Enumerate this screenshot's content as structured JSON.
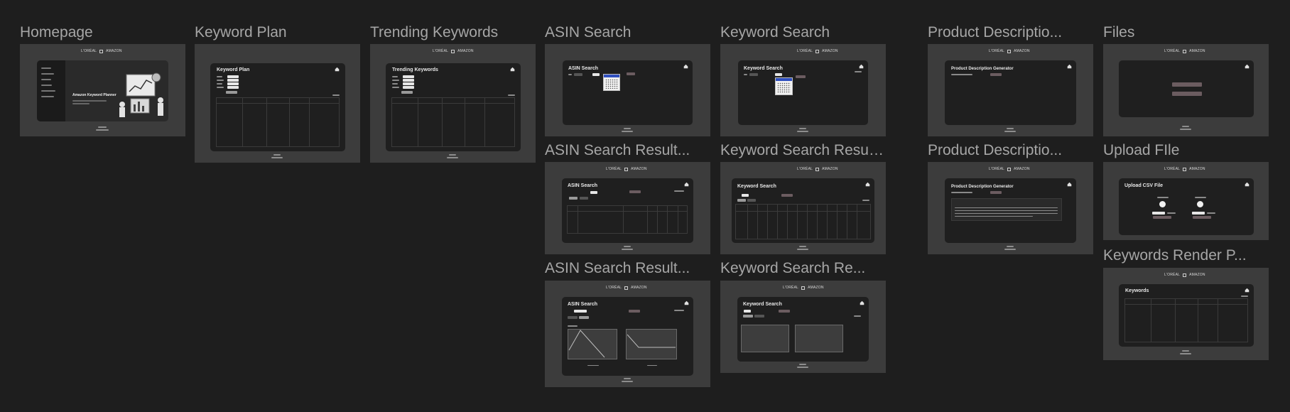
{
  "canvas": {
    "background": "#1e1e1e"
  },
  "brand": {
    "logo_left": "L'ORÉAL",
    "logo_right": "AMAZON"
  },
  "frames": [
    {
      "id": "homepage",
      "label": "Homepage",
      "kind": "homepage"
    },
    {
      "id": "keyword-plan",
      "label": "Keyword Plan",
      "kind": "table",
      "card_title": "Keyword Plan"
    },
    {
      "id": "trending-keywords",
      "label": "Trending Keywords",
      "kind": "table",
      "card_title": "Trending Keywords"
    },
    {
      "id": "asin-search",
      "label": "ASIN Search",
      "kind": "search-calendar",
      "card_title": "ASIN Search"
    },
    {
      "id": "keyword-search",
      "label": "Keyword Search",
      "kind": "search-calendar",
      "card_title": "Keyword Search"
    },
    {
      "id": "product-description",
      "label": "Product Descriptio...",
      "kind": "product-desc",
      "card_title": "Product Description Generator"
    },
    {
      "id": "files",
      "label": "Files",
      "kind": "files"
    },
    {
      "id": "asin-search-result-1",
      "label": "ASIN Search Result...",
      "kind": "asin-result",
      "card_title": "ASIN Search"
    },
    {
      "id": "keyword-search-result-1",
      "label": "Keyword Search Result ...",
      "kind": "keyword-result-table",
      "card_title": "Keyword Search"
    },
    {
      "id": "product-description-2",
      "label": "Product Descriptio...",
      "kind": "product-desc-result",
      "card_title": "Product Description Generator"
    },
    {
      "id": "upload-file",
      "label": "Upload FIle",
      "kind": "upload",
      "card_title": "Upload CSV File"
    },
    {
      "id": "asin-search-result-2",
      "label": "ASIN Search Result...",
      "kind": "asin-chart",
      "card_title": "ASIN Search"
    },
    {
      "id": "keyword-search-result-2",
      "label": "Keyword Search Re...",
      "kind": "keyword-chart",
      "card_title": "Keyword Search"
    },
    {
      "id": "keywords-render",
      "label": "Keywords Render P...",
      "kind": "table",
      "card_title": "Keywords"
    }
  ],
  "homepage": {
    "hero_title": "Amazon Keyword Planner"
  }
}
